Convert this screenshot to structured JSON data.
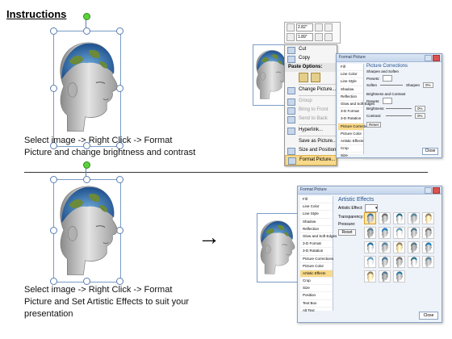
{
  "title": "Instructions",
  "step1": {
    "caption_line1": "Select image -> Right Click -> Format",
    "caption_line2": "Picture and change brightness and contrast"
  },
  "step2": {
    "caption_line1": "Select image -> Right Click -> Format",
    "caption_line2": "Picture and Set Artistic Effects to suit your",
    "caption_line3": "presentation"
  },
  "arrow_glyph": "→",
  "toolbar": {
    "height_value": "2.82\"",
    "width_value": "1.89\""
  },
  "context_menu": {
    "items": [
      {
        "label": "Cut",
        "state": "normal"
      },
      {
        "label": "Copy",
        "state": "normal"
      },
      {
        "label": "Paste Options:",
        "state": "header"
      },
      {
        "label": "Change Picture...",
        "state": "normal"
      },
      {
        "label": "Group",
        "state": "dim"
      },
      {
        "label": "Bring to Front",
        "state": "dim"
      },
      {
        "label": "Send to Back",
        "state": "dim"
      },
      {
        "label": "Hyperlink...",
        "state": "normal"
      },
      {
        "label": "Save as Picture...",
        "state": "normal"
      },
      {
        "label": "Size and Position...",
        "state": "normal"
      },
      {
        "label": "Format Picture...",
        "state": "highlighted"
      }
    ]
  },
  "dialog1": {
    "title": "Format Picture",
    "sidebar": [
      "Fill",
      "Line Color",
      "Line Style",
      "Shadow",
      "Reflection",
      "Glow and Soft Edges",
      "3-D Format",
      "3-D Rotation",
      "Picture Corrections",
      "Picture Color",
      "Artistic Effects",
      "Crop",
      "Size",
      "Position",
      "Text Box",
      "Alt Text"
    ],
    "selected": "Picture Corrections",
    "heading": "Picture Corrections",
    "sharpen_section": "Sharpen and Soften",
    "presets_label": "Presets:",
    "soften_label": "Soften",
    "sharpen_label": "Sharpen",
    "sharpen_value": "0%",
    "bc_section": "Brightness and Contrast",
    "brightness_label": "Brightness:",
    "brightness_value": "0%",
    "contrast_label": "Contrast:",
    "contrast_value": "0%",
    "reset_label": "Reset",
    "close_label": "Close"
  },
  "dialog2": {
    "title": "Format Picture",
    "sidebar": [
      "Fill",
      "Line Color",
      "Line Style",
      "Shadow",
      "Reflection",
      "Glow and Soft Edges",
      "3-D Format",
      "3-D Rotation",
      "Picture Corrections",
      "Picture Color",
      "Artistic Effects",
      "Crop",
      "Size",
      "Position",
      "Text Box",
      "Alt Text"
    ],
    "selected": "Artistic Effects",
    "heading": "Artistic Effects",
    "effect_label": "Artistic Effect:",
    "transparency_label": "Transparency:",
    "pressure_label": "Pressure:",
    "reset_label": "Reset",
    "close_label": "Close",
    "effect_count": 23
  },
  "colors": {
    "selection": "#5a7fb0",
    "rotate_handle": "#5cd13c",
    "highlight": "#f9d98a",
    "dialog_bg": "#eef3fa"
  }
}
